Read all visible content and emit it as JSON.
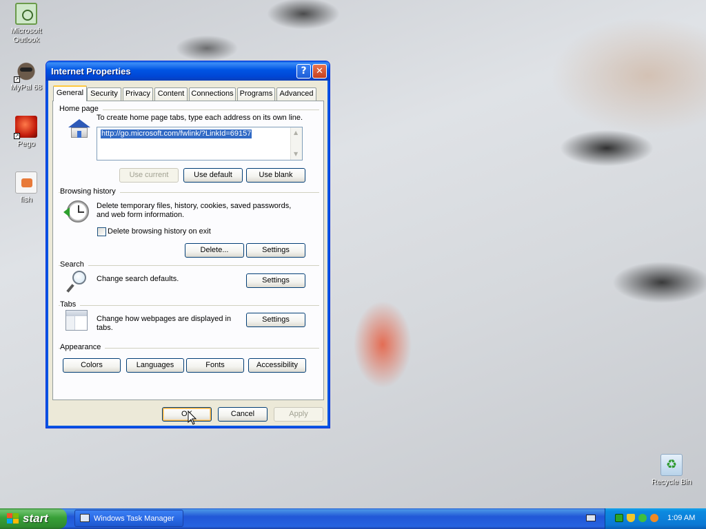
{
  "desktop": {
    "icons": [
      {
        "label": "Microsoft\nOutlook",
        "icon": "outlook-icon"
      },
      {
        "label": "MyPal 68",
        "icon": "mypal-icon"
      },
      {
        "label": "Pego",
        "icon": "pego-icon"
      },
      {
        "label": "fish",
        "icon": "image-file-icon"
      },
      {
        "label": "Recycle Bin",
        "icon": "recycle-bin-icon"
      }
    ]
  },
  "dialog": {
    "title": "Internet Properties",
    "help_glyph": "?",
    "close_glyph": "✕",
    "tabs": [
      "General",
      "Security",
      "Privacy",
      "Content",
      "Connections",
      "Programs",
      "Advanced"
    ],
    "active_tab": "General",
    "home_page": {
      "heading": "Home page",
      "instruction": "To create home page tabs, type each address on its own line.",
      "url": "http://go.microsoft.com/fwlink/?LinkId=69157",
      "use_current": "Use current",
      "use_default": "Use default",
      "use_blank": "Use blank"
    },
    "browsing_history": {
      "heading": "Browsing history",
      "description": "Delete temporary files, history, cookies, saved passwords, and web form information.",
      "checkbox_label": "Delete browsing history on exit",
      "checkbox_checked": false,
      "delete_button": "Delete...",
      "settings_button": "Settings"
    },
    "search": {
      "heading": "Search",
      "description": "Change search defaults.",
      "settings_button": "Settings"
    },
    "tabs_section": {
      "heading": "Tabs",
      "description": "Change how webpages are displayed in tabs.",
      "settings_button": "Settings"
    },
    "appearance": {
      "heading": "Appearance",
      "colors": "Colors",
      "languages": "Languages",
      "fonts": "Fonts",
      "accessibility": "Accessibility"
    },
    "footer": {
      "ok": "OK",
      "cancel": "Cancel",
      "apply": "Apply"
    }
  },
  "taskbar": {
    "start_label": "start",
    "tasks": [
      {
        "label": "Windows Task Manager",
        "icon": "task-manager-icon"
      }
    ],
    "clock": "1:09 AM"
  },
  "colors": {
    "titlebar": "#0054e3",
    "dialog_bg": "#ece9d8",
    "taskbar": "#2457d5",
    "start_button": "#38a038",
    "selection": "#316ac5"
  }
}
